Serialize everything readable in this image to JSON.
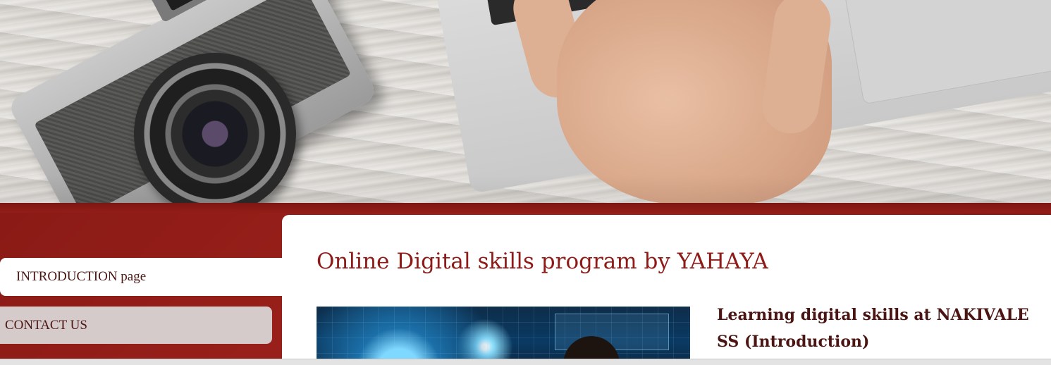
{
  "nav": {
    "items": [
      {
        "label": "INTRODUCTION page",
        "active": true
      },
      {
        "label": "CONTACT US",
        "active": false
      }
    ]
  },
  "main": {
    "title": "Online Digital skills program by YAHAYA",
    "subheading": "Learning digital skills at NAKIVALE SS (Introduction)"
  },
  "hero": {
    "key_label": "tab"
  },
  "colors": {
    "brand_red": "#8e1b18",
    "text_dark": "#4a1512",
    "nav_inactive_bg": "#d6cbcb"
  }
}
